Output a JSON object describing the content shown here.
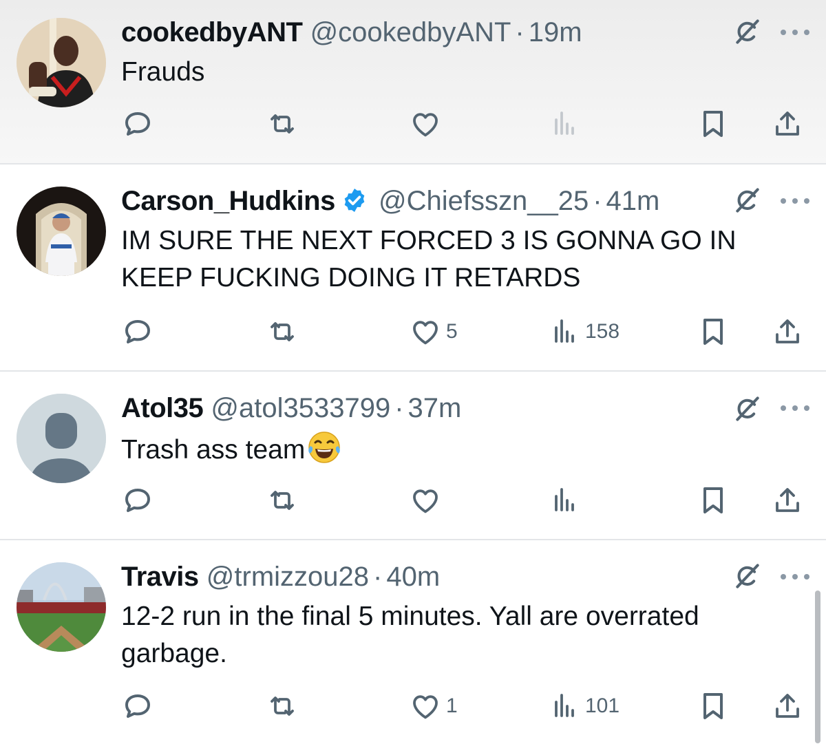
{
  "colors": {
    "text": "#0f1419",
    "muted": "#536471",
    "verified": "#1d9bf0",
    "divider": "#e3e5e8"
  },
  "icons": [
    "reply-icon",
    "retweet-icon",
    "like-icon",
    "views-icon",
    "bookmark-icon",
    "share-icon",
    "grok-icon",
    "more-icon",
    "verified-icon"
  ],
  "tweets": [
    {
      "name": "cookedbyANT",
      "handle": "@cookedbyANT",
      "dot": "·",
      "time": "19m",
      "text": "Frauds",
      "likes": "",
      "views": ""
    },
    {
      "name": "Carson_Hudkins",
      "handle": "@Chiefsszn__25",
      "dot": "·",
      "time": "41m",
      "text": "IM SURE THE NEXT FORCED 3 IS GONNA GO IN KEEP FUCKING DOING IT RETARDS",
      "likes": "5",
      "views": "158"
    },
    {
      "name": "Atol35",
      "handle": "@atol3533799",
      "dot": "·",
      "time": "37m",
      "text": "Trash ass team",
      "likes": "",
      "views": ""
    },
    {
      "name": "Travis",
      "handle": "@trmizzou28",
      "dot": "·",
      "time": "40m",
      "text": "12-2 run in the final 5 minutes. Yall are overrated garbage.",
      "likes": "1",
      "views": "101"
    }
  ]
}
